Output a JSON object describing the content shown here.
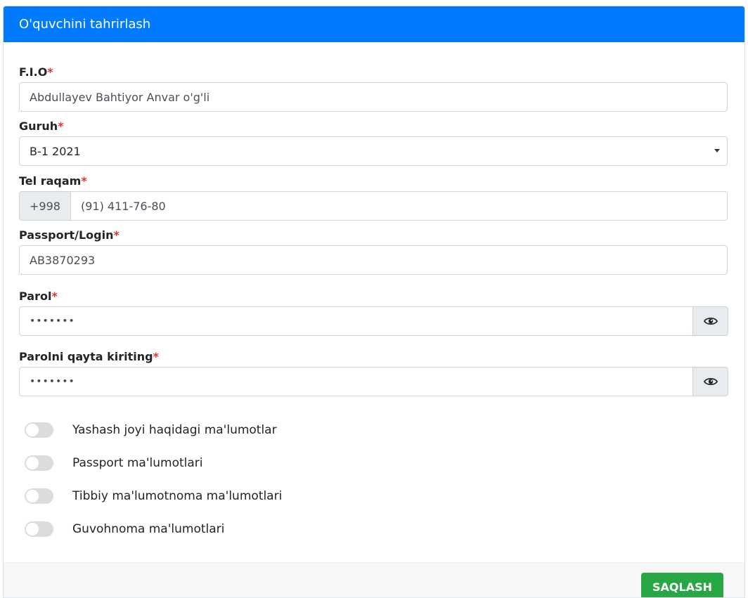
{
  "header": {
    "title": "O'quvchini tahrirlash"
  },
  "form": {
    "required_mark": "*",
    "fio": {
      "label": "F.I.O",
      "value": "Abdullayev Bahtiyor Anvar o'g'li"
    },
    "group": {
      "label": "Guruh",
      "value": "B-1 2021"
    },
    "phone": {
      "label": "Tel raqam",
      "prefix": "+998",
      "value": "(91) 411-76-80"
    },
    "passport": {
      "label": "Passport/Login",
      "value": "AB3870293"
    },
    "password": {
      "label": "Parol",
      "value": "•••••••"
    },
    "password_repeat": {
      "label": "Parolni qayta kiriting",
      "value": "•••••••"
    }
  },
  "toggles": [
    {
      "label": "Yashash joyi haqidagi ma'lumotlar",
      "on": false
    },
    {
      "label": "Passport ma'lumotlari",
      "on": false
    },
    {
      "label": "Tibbiy ma'lumotnoma ma'lumotlari",
      "on": false
    },
    {
      "label": "Guvohnoma ma'lumotlari",
      "on": false
    }
  ],
  "footer": {
    "save_label": "SAQLASH"
  },
  "icons": {
    "show_password": "eye-icon"
  },
  "colors": {
    "header": "#007bff",
    "save": "#28a745",
    "required": "#e3342f"
  }
}
